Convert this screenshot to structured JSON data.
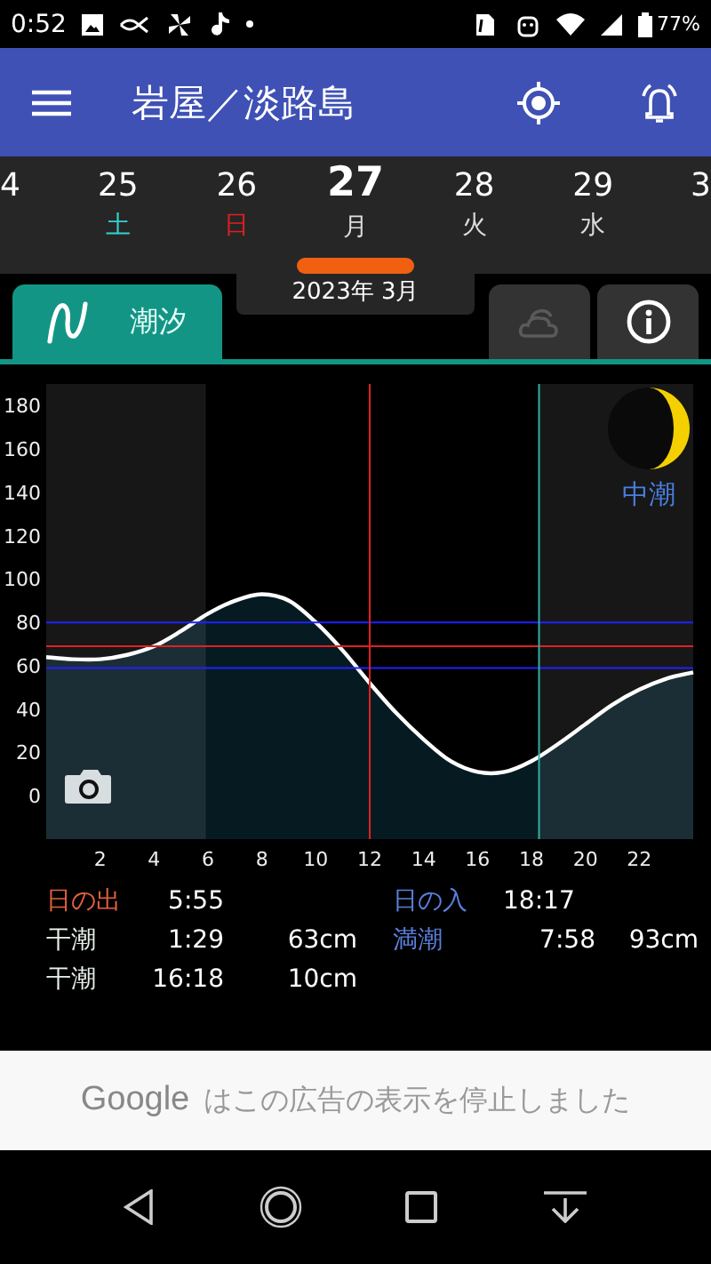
{
  "status_bar": {
    "time": "0:52",
    "battery": "77%"
  },
  "app_bar": {
    "title": "岩屋／淡路島"
  },
  "dates": [
    {
      "day": "4",
      "selected": false
    },
    {
      "day": "25",
      "weekday": "土",
      "color": "#35d0d0",
      "selected": false
    },
    {
      "day": "26",
      "weekday": "日",
      "color": "#e02020",
      "selected": false
    },
    {
      "day": "27",
      "weekday": "月",
      "color": "#dddddd",
      "selected": true
    },
    {
      "day": "28",
      "weekday": "火",
      "color": "#dddddd",
      "selected": false
    },
    {
      "day": "29",
      "weekday": "水",
      "color": "#dddddd",
      "selected": false
    },
    {
      "day": "3",
      "selected": false
    }
  ],
  "month": "2023年 3月",
  "tabs": [
    {
      "kind": "tide",
      "label": "潮汐",
      "selected": true,
      "disabled": false
    },
    {
      "kind": "weather",
      "selected": false,
      "disabled": true
    },
    {
      "kind": "info",
      "selected": false,
      "disabled": false
    }
  ],
  "tide_chart": {
    "moon_age_label": "中潮",
    "chart_data": {
      "type": "line",
      "x": [
        0,
        1,
        2,
        3,
        4,
        5,
        6,
        7,
        8,
        9,
        10,
        11,
        12,
        13,
        14,
        15,
        16,
        17,
        18,
        19,
        20,
        21,
        22,
        23,
        24
      ],
      "series": [
        {
          "color": "#ffffff",
          "values": [
            64,
            63,
            63,
            65,
            69,
            76,
            84,
            90,
            93,
            90,
            80,
            67,
            52,
            38,
            26,
            16,
            11,
            11,
            16,
            24,
            33,
            42,
            49,
            54,
            57
          ]
        }
      ],
      "xlim": [
        0,
        24
      ],
      "ylim": [
        -20,
        190
      ],
      "xticks": [
        2,
        4,
        6,
        8,
        10,
        12,
        14,
        16,
        18,
        20,
        22
      ],
      "yticks": [
        0,
        20,
        40,
        60,
        80,
        100,
        120,
        140,
        160,
        180
      ],
      "bands": [
        {
          "axis": "x",
          "from": 0,
          "to": 5.92
        },
        {
          "axis": "x",
          "from": 18.28,
          "to": 24
        }
      ],
      "ref_lines": [
        {
          "axis": "y",
          "value": 80,
          "color": "#2020ff"
        },
        {
          "axis": "y",
          "value": 59,
          "color": "#2020ff"
        },
        {
          "axis": "y",
          "value": 69,
          "color": "#e02020"
        },
        {
          "axis": "x",
          "value": 12,
          "color": "#e02020"
        },
        {
          "axis": "x",
          "value": 18.28,
          "color": "#30b0a0"
        }
      ]
    }
  },
  "sun": [
    {
      "label": "日の出",
      "time": "5:55",
      "color": "#e0603f"
    },
    {
      "label": "日の入",
      "time": "18:17",
      "color": "#5a7fdc"
    }
  ],
  "tides": [
    {
      "kind": "low",
      "label": "干潮",
      "time": "1:29",
      "height": "63cm"
    },
    {
      "kind": "high",
      "label": "満潮",
      "time": "7:58",
      "height": "93cm"
    },
    {
      "kind": "low",
      "label": "干潮",
      "time": "16:18",
      "height": "10cm"
    }
  ],
  "ad": {
    "brand": "Google",
    "message": "はこの広告の表示を停止しました"
  }
}
